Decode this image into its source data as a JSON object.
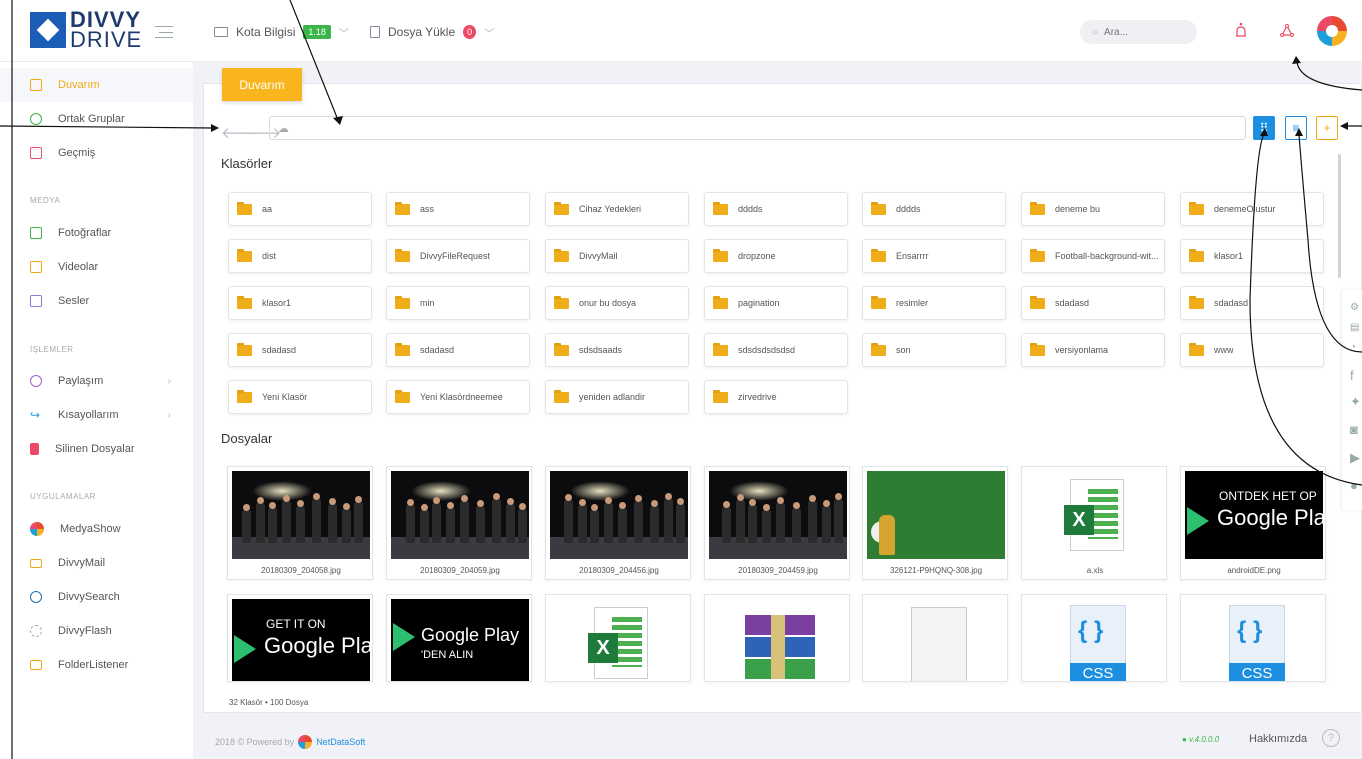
{
  "header": {
    "logo_top": "DIVVY",
    "logo_bottom": "DRIVE",
    "quota_label": "Kota Bilgisi",
    "quota_badge": "1.18",
    "upload_label": "Dosya Yükle",
    "upload_badge": "0",
    "search_placeholder": "Ara...",
    "colors": {
      "accent": "#f9b51d",
      "quota_badge": "#3ab54a",
      "upload_badge": "#ec4a64",
      "brand": "#1c5db8"
    }
  },
  "sidebar": {
    "items": [
      {
        "label": "Duvarım",
        "icon": "wall-icon"
      },
      {
        "label": "Ortak Gruplar",
        "icon": "group-icon"
      },
      {
        "label": "Geçmiş",
        "icon": "history-icon"
      }
    ],
    "media_head": "MEDYA",
    "media": [
      {
        "label": "Fotoğraflar",
        "icon": "photo-icon"
      },
      {
        "label": "Videolar",
        "icon": "video-icon"
      },
      {
        "label": "Sesler",
        "icon": "audio-icon"
      }
    ],
    "ops_head": "İŞLEMLER",
    "ops": [
      {
        "label": "Paylaşım",
        "icon": "share-icon"
      },
      {
        "label": "Kısayollarım",
        "icon": "shortcut-icon"
      },
      {
        "label": "Silinen Dosyalar",
        "icon": "trash-icon"
      }
    ],
    "apps_head": "UYGULAMALAR",
    "apps": [
      {
        "label": "MedyaShow",
        "icon": "medyashow-icon"
      },
      {
        "label": "DivvyMail",
        "icon": "mail-icon"
      },
      {
        "label": "DivvySearch",
        "icon": "search-icon"
      },
      {
        "label": "DivvyFlash",
        "icon": "flash-icon"
      },
      {
        "label": "FolderListener",
        "icon": "folder-listener-icon"
      }
    ]
  },
  "main": {
    "tab_title": "Duvarım",
    "folders_head": "Klasörler",
    "files_head": "Dosyalar",
    "folders": [
      "aa",
      "ass",
      "Cihaz Yedekleri",
      "dddds",
      "dddds",
      "deneme bu",
      "denemeOlustur",
      "dist",
      "DivvyFileRequest",
      "DivvyMail",
      "dropzone",
      "Ensarrrr",
      "Football-background-wit...",
      "klasor1",
      "klasor1",
      "min",
      "onur bu dosya",
      "pagination",
      "resimler",
      "sdadasd",
      "sdadasd",
      "sdadasd",
      "sdadasd",
      "sdsdsaads",
      "sdsdsdsdsdsd",
      "son",
      "versiyonlama",
      "www",
      "Yeni Klasör",
      "Yeni Klasördneemee",
      "yeniden adlandir",
      "zirvedrive"
    ],
    "files": [
      {
        "name": "20180309_204058.jpg",
        "kind": "photo"
      },
      {
        "name": "20180309_204059.jpg",
        "kind": "photo"
      },
      {
        "name": "20180309_204456.jpg",
        "kind": "photo"
      },
      {
        "name": "20180309_204459.jpg",
        "kind": "photo"
      },
      {
        "name": "326121-P9HQNQ-308.jpg",
        "kind": "grass"
      },
      {
        "name": "a.xls",
        "kind": "excel"
      },
      {
        "name": "androidDE.png",
        "kind": "gplay-de"
      }
    ],
    "files_row2": [
      {
        "kind": "gplay-en",
        "top": "GET IT ON",
        "bottom": "Google Pla"
      },
      {
        "kind": "gplay-tr",
        "top": "Google Play",
        "bottom": "'DEN ALIN"
      },
      {
        "kind": "excel"
      },
      {
        "kind": "rar"
      },
      {
        "kind": "blank"
      },
      {
        "kind": "css",
        "label": "CSS"
      },
      {
        "kind": "css",
        "label": "CSS"
      }
    ],
    "gplay_de_top": "ONTDEK HET OP",
    "gplay_de_bottom": "Google Pla",
    "count_text": "32 Klasör  •  100 Dosya"
  },
  "footer": {
    "copyright": "2018 © Powered by",
    "company": "NetDataSoft",
    "version": "● v.4.0.0.0",
    "about": "Hakkımızda",
    "help": "?"
  }
}
